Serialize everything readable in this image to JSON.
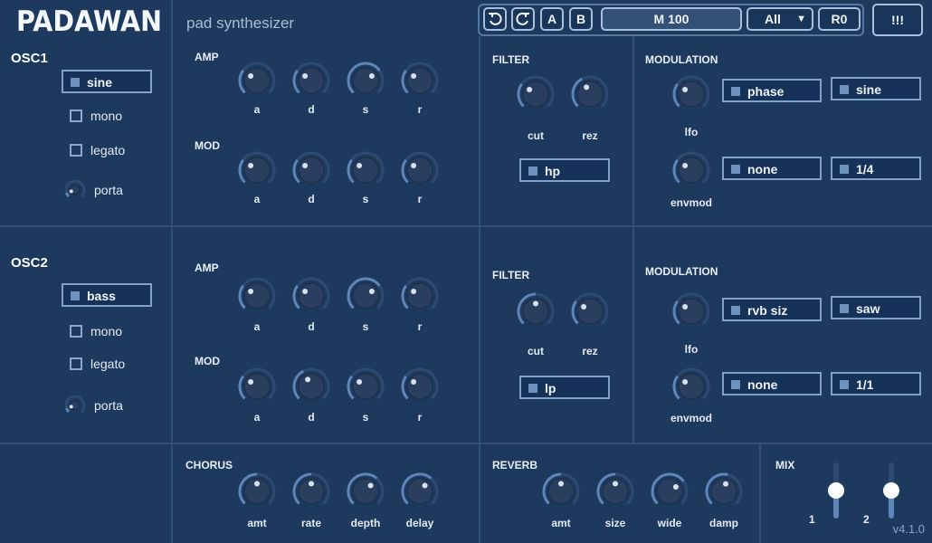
{
  "app": {
    "title": "PADAWAN",
    "subtitle": "pad synthesizer",
    "version": "v4.1.0"
  },
  "toolbar": {
    "undo_icon": "undo-icon",
    "redo_icon": "redo-icon",
    "a_label": "A",
    "b_label": "B",
    "preset": "M 100",
    "category": "All",
    "rank": "R0",
    "menu": "!!!"
  },
  "osc1": {
    "title": "OSC1",
    "wave": "sine",
    "mono": "mono",
    "legato": "legato",
    "porta": "porta",
    "amp_title": "AMP",
    "mod_title": "MOD",
    "amp_knobs": [
      {
        "label": "a",
        "value": 0.3
      },
      {
        "label": "d",
        "value": 0.3
      },
      {
        "label": "s",
        "value": 0.7
      },
      {
        "label": "r",
        "value": 0.3
      }
    ],
    "mod_knobs": [
      {
        "label": "a",
        "value": 0.3
      },
      {
        "label": "d",
        "value": 0.3
      },
      {
        "label": "s",
        "value": 0.3
      },
      {
        "label": "r",
        "value": 0.3
      }
    ],
    "filter": {
      "title": "FILTER",
      "cut": "cut",
      "rez": "rez",
      "type": "hp",
      "cut_value": 0.3,
      "rez_value": 0.4
    },
    "modulation": {
      "title": "MODULATION",
      "lfo": "lfo",
      "envmod": "envmod",
      "lfo_target": "phase",
      "lfo_wave": "sine",
      "env_target": "none",
      "env_rate": "1/4",
      "lfo_value": 0.3,
      "env_value": 0.3
    }
  },
  "osc2": {
    "title": "OSC2",
    "wave": "bass",
    "mono": "mono",
    "legato": "legato",
    "porta": "porta",
    "amp_title": "AMP",
    "mod_title": "MOD",
    "amp_knobs": [
      {
        "label": "a",
        "value": 0.3
      },
      {
        "label": "d",
        "value": 0.3
      },
      {
        "label": "s",
        "value": 0.7
      },
      {
        "label": "r",
        "value": 0.3
      }
    ],
    "mod_knobs": [
      {
        "label": "a",
        "value": 0.3
      },
      {
        "label": "d",
        "value": 0.4
      },
      {
        "label": "s",
        "value": 0.3
      },
      {
        "label": "r",
        "value": 0.3
      }
    ],
    "filter": {
      "title": "FILTER",
      "cut": "cut",
      "rez": "rez",
      "type": "lp",
      "cut_value": 0.5,
      "rez_value": 0.3
    },
    "modulation": {
      "title": "MODULATION",
      "lfo": "lfo",
      "envmod": "envmod",
      "lfo_target": "rvb siz",
      "lfo_wave": "saw",
      "env_target": "none",
      "env_rate": "1/1",
      "lfo_value": 0.3,
      "env_value": 0.3
    }
  },
  "chorus": {
    "title": "CHORUS",
    "knobs": [
      {
        "label": "amt",
        "value": 0.5
      },
      {
        "label": "rate",
        "value": 0.5
      },
      {
        "label": "depth",
        "value": 0.65
      },
      {
        "label": "delay",
        "value": 0.65
      }
    ]
  },
  "reverb": {
    "title": "REVERB",
    "knobs": [
      {
        "label": "amt",
        "value": 0.5
      },
      {
        "label": "size",
        "value": 0.5
      },
      {
        "label": "wide",
        "value": 0.7
      },
      {
        "label": "damp",
        "value": 0.55
      }
    ]
  },
  "mix": {
    "title": "MIX",
    "ch1": "1",
    "ch2": "2",
    "ch1_level": 0.5,
    "ch2_level": 0.5
  },
  "colors": {
    "bg": "#1d3a5e",
    "accent": "#5d85b8",
    "knob": "#2a3f5f"
  }
}
